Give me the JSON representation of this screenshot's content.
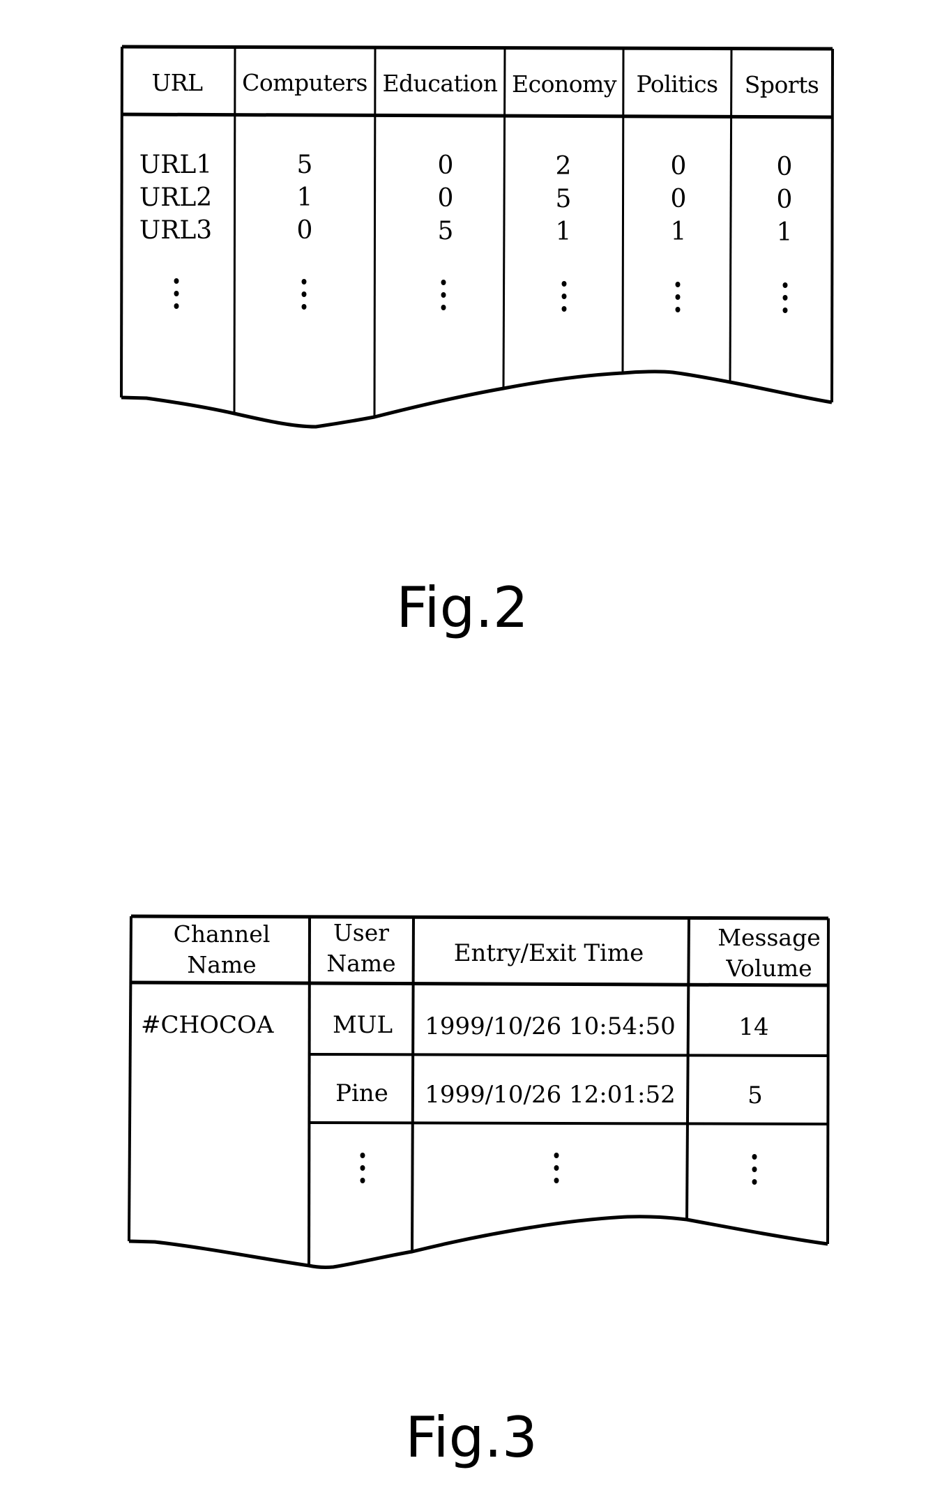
{
  "fig2": {
    "caption": "Fig.2",
    "headers": [
      "URL",
      "Computers",
      "Education",
      "Economy",
      "Politics",
      "Sports"
    ],
    "rows": [
      {
        "url": "URL1",
        "values": [
          "5",
          "0",
          "2",
          "0",
          "0"
        ]
      },
      {
        "url": "URL2",
        "values": [
          "1",
          "0",
          "5",
          "0",
          "0"
        ]
      },
      {
        "url": "URL3",
        "values": [
          "0",
          "5",
          "1",
          "1",
          "1"
        ]
      }
    ],
    "continuation": "vertical-ellipsis"
  },
  "fig3": {
    "caption": "Fig.3",
    "headers": {
      "channel_line1": "Channel",
      "channel_line2": "Name",
      "user_line1": "User",
      "user_line2": "Name",
      "time": "Entry/Exit Time",
      "volume_line1": "Message",
      "volume_line2": "Volume"
    },
    "channel": "#CHOCOA",
    "rows": [
      {
        "user": "MUL",
        "time": "1999/10/26 10:54:50",
        "volume": "14"
      },
      {
        "user": "Pine",
        "time": "1999/10/26 12:01:52",
        "volume": "5"
      }
    ],
    "continuation": "vertical-ellipsis"
  }
}
